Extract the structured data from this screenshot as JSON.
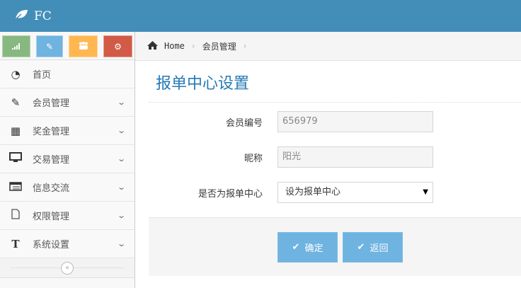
{
  "navbar": {
    "brand": "FC",
    "logo_icon": "leaf-icon"
  },
  "shortcuts": [
    {
      "icon": "signal-icon",
      "color": "#87b87f"
    },
    {
      "icon": "pencil-icon",
      "color": "#6fb3e0"
    },
    {
      "icon": "users-icon",
      "color": "#ffb752"
    },
    {
      "icon": "cogs-icon",
      "color": "#d15b47"
    }
  ],
  "menu": [
    {
      "label": "首页",
      "icon": "dashboard-icon"
    },
    {
      "label": "会员管理",
      "icon": "edit-icon"
    },
    {
      "label": "奖金管理",
      "icon": "calendar-icon"
    },
    {
      "label": "交易管理",
      "icon": "desktop-icon"
    },
    {
      "label": "信息交流",
      "icon": "list-icon"
    },
    {
      "label": "权限管理",
      "icon": "file-icon"
    },
    {
      "label": "系统设置",
      "icon": "text-width-icon"
    }
  ],
  "breadcrumb": {
    "home": "Home",
    "current": "会员管理"
  },
  "page": {
    "title": "报单中心设置"
  },
  "form": {
    "member_id": {
      "label": "会员编号",
      "value": "656979"
    },
    "nickname": {
      "label": "昵称",
      "value": "阳光"
    },
    "is_center": {
      "label": "是否为报单中心",
      "value": "设为报单中心"
    }
  },
  "buttons": {
    "confirm": "确定",
    "back": "返回"
  }
}
